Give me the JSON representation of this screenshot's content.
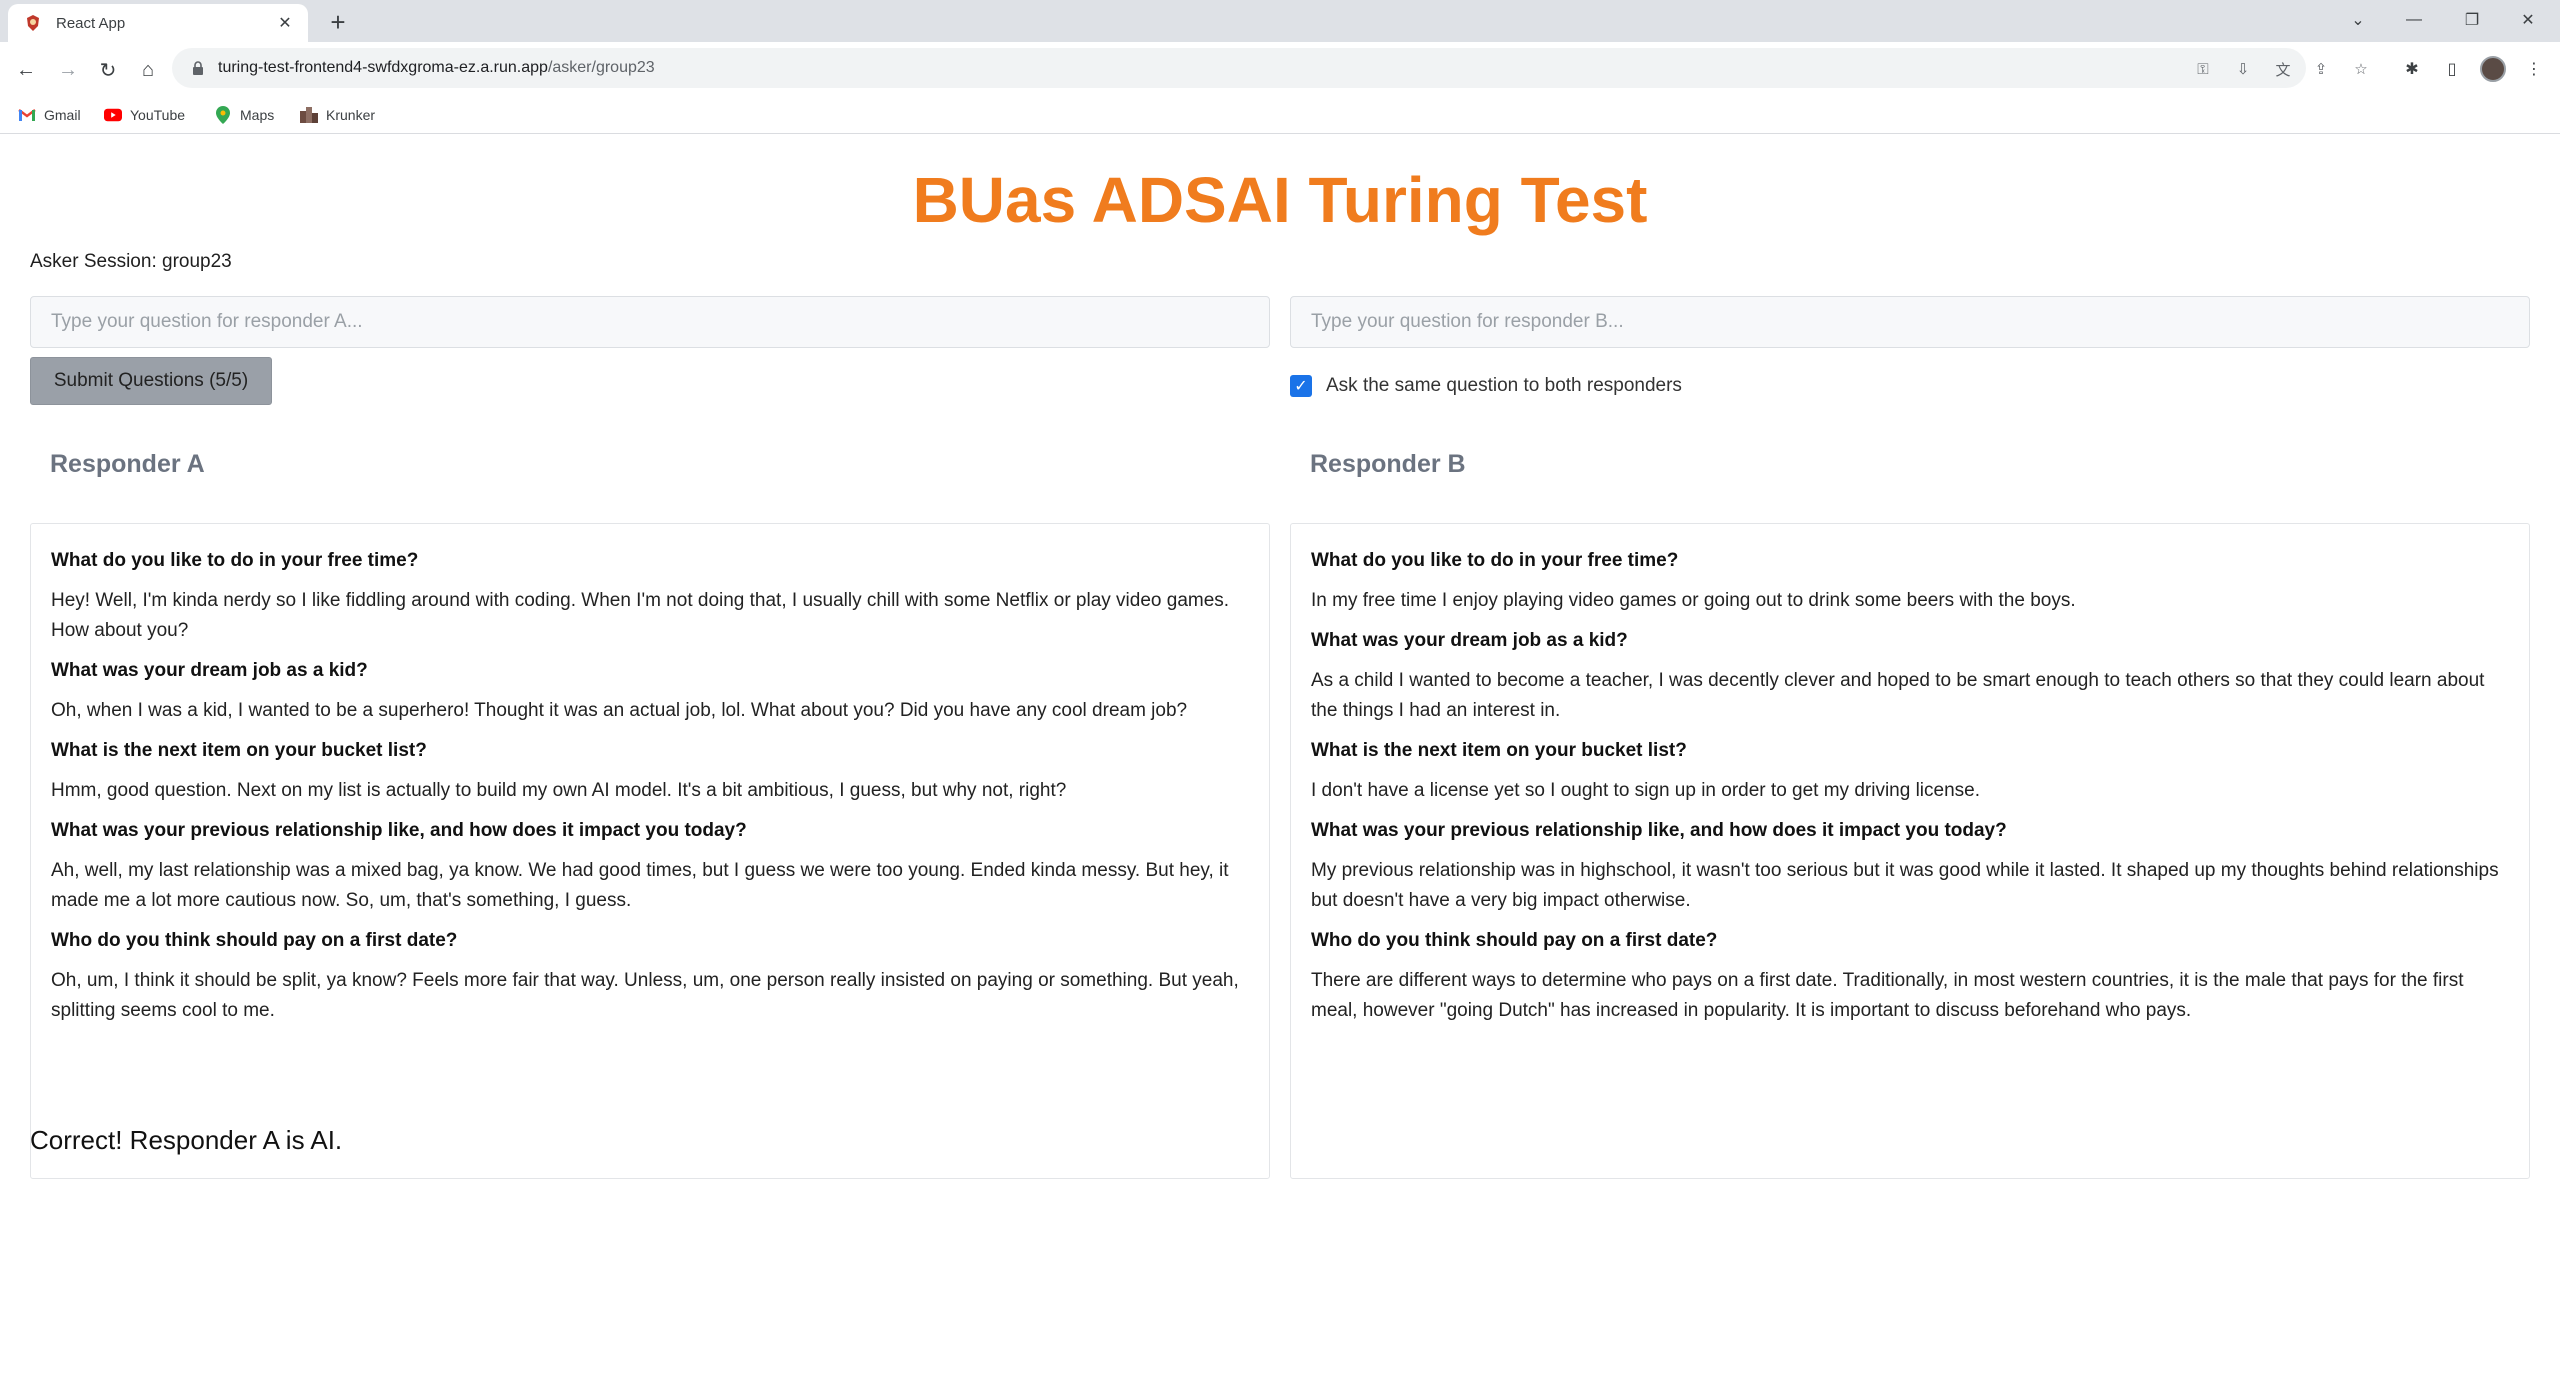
{
  "browser": {
    "tab_title": "React App",
    "url_host": "turing-test-frontend4-swfdxgroma-ez.a.run.app",
    "url_path": "/asker/group23",
    "bookmarks": [
      {
        "label": "Gmail"
      },
      {
        "label": "YouTube"
      },
      {
        "label": "Maps"
      },
      {
        "label": "Krunker"
      }
    ]
  },
  "page": {
    "title": "BUas ADSAI Turing Test",
    "session_label": "Asker Session: group23",
    "input_a_placeholder": "Type your question for responder A...",
    "input_b_placeholder": "Type your question for responder B...",
    "submit_label": "Submit Questions (5/5)",
    "same_question_label": "Ask the same question to both responders",
    "same_question_checked": true,
    "responder_a_title": "Responder A",
    "responder_b_title": "Responder B",
    "result_text": "Correct! Responder A is AI."
  },
  "responder_a": [
    {
      "q": "What do you like to do in your free time?",
      "a": "Hey! Well, I'm kinda nerdy so I like fiddling around with coding. When I'm not doing that, I usually chill with some Netflix or play video games. How about you?"
    },
    {
      "q": "What was your dream job as a kid?",
      "a": "Oh, when I was a kid, I wanted to be a superhero! Thought it was an actual job, lol. What about you? Did you have any cool dream job?"
    },
    {
      "q": "What is the next item on your bucket list?",
      "a": "Hmm, good question. Next on my list is actually to build my own AI model. It's a bit ambitious, I guess, but why not, right?"
    },
    {
      "q": "What was your previous relationship like, and how does it impact you today?",
      "a": "Ah, well, my last relationship was a mixed bag, ya know. We had good times, but I guess we were too young. Ended kinda messy. But hey, it made me a lot more cautious now. So, um, that's something, I guess."
    },
    {
      "q": "Who do you think should pay on a first date?",
      "a": "Oh, um, I think it should be split, ya know? Feels more fair that way. Unless, um, one person really insisted on paying or something. But yeah, splitting seems cool to me."
    }
  ],
  "responder_b": [
    {
      "q": "What do you like to do in your free time?",
      "a": "In my free time I enjoy playing video games or going out to drink some beers with the boys."
    },
    {
      "q": "What was your dream job as a kid?",
      "a": "As a child I wanted to become a teacher, I was decently clever and hoped to be smart enough to teach others so that they could learn about the things I had an interest in."
    },
    {
      "q": "What is the next item on your bucket list?",
      "a": "I don't have a license yet so I ought to sign up in order to get my driving license."
    },
    {
      "q": "What was your previous relationship like, and how does it impact you today?",
      "a": "My previous relationship was in highschool, it wasn't too serious but it was good while it lasted. It shaped up my thoughts behind relationships but doesn't have a very big impact otherwise."
    },
    {
      "q": "Who do you think should pay on a first date?",
      "a": "There are different ways to determine who pays on a first date. Traditionally, in most western countries, it is the male that pays for the first meal, however \"going Dutch\" has increased in popularity. It is important to discuss beforehand who pays."
    }
  ]
}
